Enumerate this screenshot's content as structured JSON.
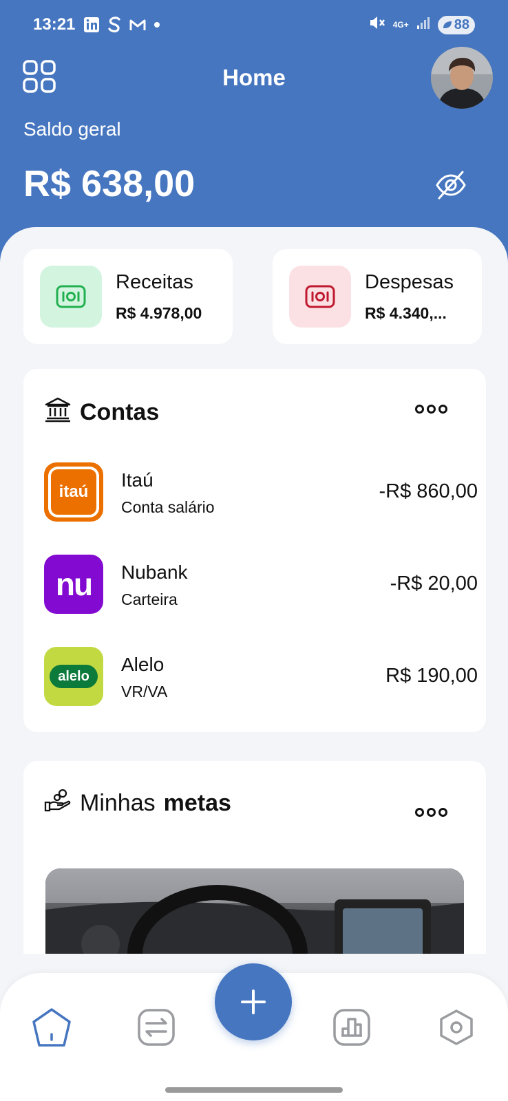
{
  "status_bar": {
    "time": "13:21",
    "battery": "88",
    "network": "4G+",
    "app_icons": [
      "linkedin-icon",
      "s-icon",
      "gmail-icon",
      "dot-icon"
    ]
  },
  "header": {
    "title": "Home",
    "balance_label": "Saldo geral",
    "balance_value": "R$ 638,00"
  },
  "summary": {
    "income": {
      "label": "Receitas",
      "value": "R$ 4.978,00",
      "color": "#22b04f"
    },
    "expense": {
      "label": "Despesas",
      "value": "R$ 4.340,...",
      "color": "#c0192f"
    }
  },
  "accounts": {
    "title": "Contas",
    "items": [
      {
        "name": "Itaú",
        "type": "Conta salário",
        "balance": "-R$ 860,00",
        "logo_text": "itaú",
        "logo_color": "#ec7000"
      },
      {
        "name": "Nubank",
        "type": "Carteira",
        "balance": "-R$ 20,00",
        "logo_text": "nu",
        "logo_color": "#820ad1"
      },
      {
        "name": "Alelo",
        "type": "VR/VA",
        "balance": "R$ 190,00",
        "logo_text": "alelo",
        "logo_color": "#c3d941"
      }
    ]
  },
  "goals": {
    "title_regular": "Minhas",
    "title_bold": "metas"
  },
  "colors": {
    "primary": "#4676c0",
    "background": "#f3f5f8"
  }
}
